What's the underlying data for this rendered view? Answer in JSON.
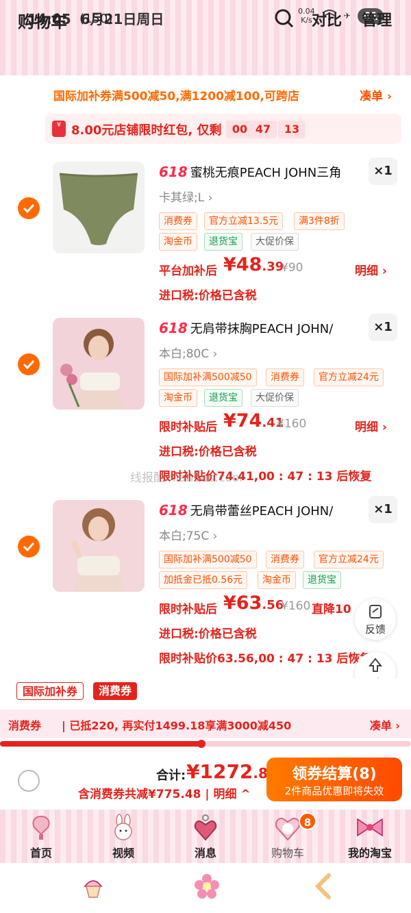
{
  "status_bar": {
    "time": "14:05",
    "date": "6月21日周日",
    "speed": "0.04",
    "speed_unit": "K/s",
    "battery": "61"
  },
  "header": {
    "title": "购物车",
    "count": "(150)",
    "compare": "对比",
    "manage": "管理"
  },
  "promo": {
    "text": "国际加补券满500减50,满1200减100,可跨店",
    "link": "凑单 ›"
  },
  "red_packet": {
    "icon": "¥",
    "text": "8.00元店铺限时红包, 仅剩",
    "h": "00",
    "m": "47",
    "s": "13",
    "sep": ":"
  },
  "items": [
    {
      "badge": "618",
      "title": "蜜桃无痕PEACH JOHN三角",
      "sku": "卡其绿;L ›",
      "qty": "×1",
      "tags_row1": [
        "消费券",
        "官方立减13.5元",
        "满3件8折"
      ],
      "tags_row2": [
        "淘金币",
        "退货宝",
        "大促价保"
      ],
      "price_label": "平台加补后",
      "price_int": "¥48",
      "price_dec": ".39",
      "price_orig": "¥90",
      "detail": "明细 ›",
      "tax": "进口税:价格已含税"
    },
    {
      "badge": "618",
      "title": "无肩带抹胸PEACH JOHN/",
      "sku": "本白;80C ›",
      "qty": "×1",
      "tags_row1": [
        "国际加补满500减50",
        "消费券",
        "官方立减24元"
      ],
      "tags_row2": [
        "淘金币",
        "退货宝",
        "大促价保"
      ],
      "price_label": "限时补贴后",
      "price_int": "¥74",
      "price_dec": ".41",
      "price_orig": "¥160",
      "detail": "明细 ›",
      "tax": "进口税:价格已含税",
      "restore": "限时补贴价74.41,00 : 47 : 13 后恢复"
    },
    {
      "badge": "618",
      "title": "无肩带蕾丝PEACH JOHN/",
      "sku": "本白;75C ›",
      "qty": "×1",
      "tags_row1": [
        "国际加补满500减50",
        "消费券",
        "官方立减24元"
      ],
      "tags_row2": [
        "加抵金已抵0.56元",
        "淘金币",
        "退货宝"
      ],
      "price_label": "限时补贴后",
      "price_int": "¥63",
      "price_dec": ".56",
      "price_orig": "¥160",
      "price_drop": "直降10",
      "tax": "进口税:价格已含税",
      "restore": "限时补贴价63.56,00 : 47 : 13 后恢复"
    }
  ],
  "float": {
    "feedback": "反馈",
    "top": "顶部"
  },
  "coupon_tabs": [
    "国际加补券",
    "消费券"
  ],
  "coupon_bar": {
    "label": "消费券",
    "text": "| 已抵220, 再实付1499.18享满3000减450",
    "link": "凑单 ›",
    "progress": 0.49
  },
  "checkout": {
    "total_label": "合计:",
    "total_int": "¥1272",
    "total_dec": ".82",
    "sub": "含消费券共减¥775.48 | 明细 ^",
    "button": "领券结算(8)",
    "button_sub": "2件商品优惠即将失效"
  },
  "tabbar": [
    {
      "label": "首页",
      "icon": "mirror-icon"
    },
    {
      "label": "视频",
      "icon": "bunny-icon"
    },
    {
      "label": "消息",
      "icon": "heart-charm-icon"
    },
    {
      "label": "购物车",
      "icon": "cart-mascot-icon",
      "badge": "8",
      "active": true
    },
    {
      "label": "我的淘宝",
      "icon": "bow-icon"
    }
  ],
  "watermark": "线报酷 xianbao.cool",
  "colors": {
    "accent": "#e4231c",
    "orange": "#ff6a00",
    "pink": "#f9d9e2"
  }
}
